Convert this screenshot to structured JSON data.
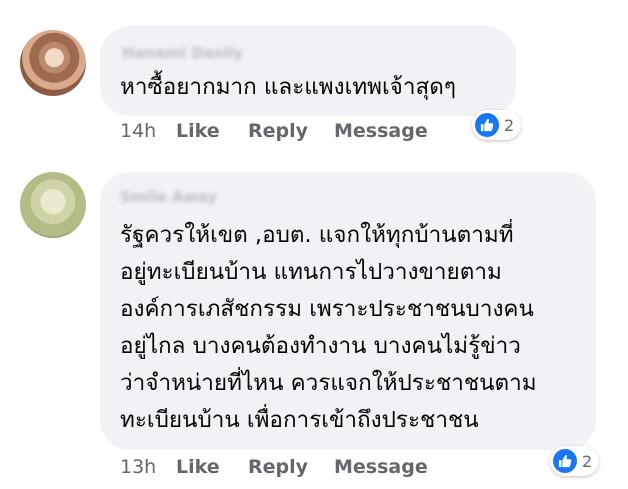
{
  "comments": [
    {
      "author": "Hanami Dasily",
      "text": "หาซื้อยากมาก และแพงเทพเจ้าสุดๆ",
      "time": "14h",
      "actions": [
        "Like",
        "Reply",
        "Message"
      ],
      "reaction_count": "2",
      "reaction_icon": "like-icon"
    },
    {
      "author": "Smile Away",
      "text": "รัฐควรให้เขต ,อบต. แจกให้ทุกบ้านตามที่\nอยู่ทะเบียนบ้าน แทนการไปวางขายตาม\nองค์การเภสัชกรรม เพราะประชาชนบางคน\nอยู่ไกล บางคนต้องทำงาน บางคนไม่รู้ข่าว\nว่าจำหน่ายที่ไหน ควรแจกให้ประชาชนตาม\nทะเบียนบ้าน เพื่อการเข้าถึงประชาชน",
      "time": "13h",
      "actions": [
        "Like",
        "Reply",
        "Message"
      ],
      "reaction_count": "2",
      "reaction_icon": "like-icon"
    }
  ],
  "colors": {
    "bubble": "#f0f2f5",
    "meta_text": "#65676b",
    "like_blue": "#1877f2"
  }
}
